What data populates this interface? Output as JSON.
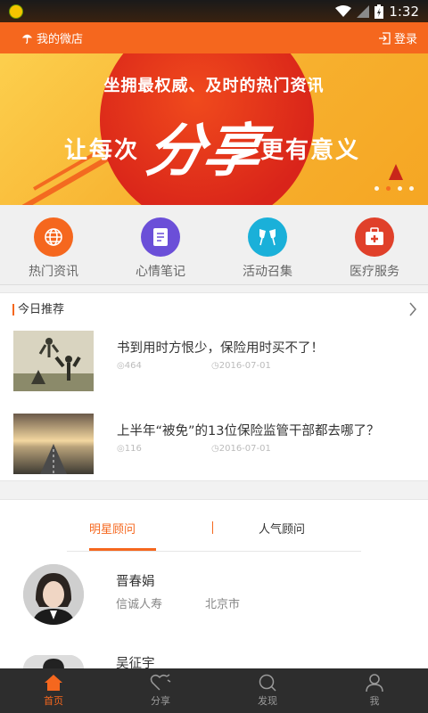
{
  "status": {
    "time": "1:32"
  },
  "header": {
    "shop_label": "我的微店",
    "login_label": "登录"
  },
  "banner": {
    "subtitle": "坐拥最权威、及时的热门资讯",
    "left_text": "让每次",
    "center_text": "分享",
    "right_text": "更有意义"
  },
  "categories": [
    {
      "label": "热门资讯",
      "icon": "globe-icon",
      "color": "#f5671e"
    },
    {
      "label": "心情笔记",
      "icon": "note-icon",
      "color": "#6b4fd8"
    },
    {
      "label": "活动召集",
      "icon": "cheers-icon",
      "color": "#1ab0d9"
    },
    {
      "label": "医疗服务",
      "icon": "medical-kit-icon",
      "color": "#e0402a"
    }
  ],
  "recommend": {
    "title": "今日推荐",
    "articles": [
      {
        "title": "书到用时方恨少，保险用时买不了！",
        "views": "464",
        "date": "2016-07-01"
      },
      {
        "title": "上半年“被免”的13位保险监管干部都去哪了？",
        "views": "116",
        "date": "2016-07-01"
      }
    ]
  },
  "consultants": {
    "tabs": [
      "明星顾问",
      "人气顾问"
    ],
    "people": [
      {
        "name": "晋春娟",
        "company": "信诚人寿",
        "city": "北京市"
      },
      {
        "name": "吴征宇",
        "company": "",
        "city": ""
      }
    ]
  },
  "nav": [
    {
      "label": "首页",
      "icon": "home-icon"
    },
    {
      "label": "分享",
      "icon": "share-heart-icon"
    },
    {
      "label": "发现",
      "icon": "search-icon"
    },
    {
      "label": "我",
      "icon": "user-icon"
    }
  ],
  "colors": {
    "accent": "#f5671e",
    "nav_bg": "#2d2d2d"
  }
}
